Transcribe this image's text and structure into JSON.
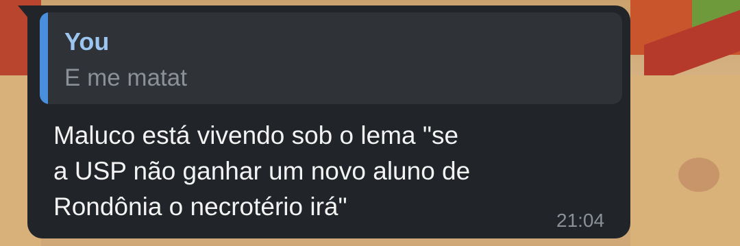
{
  "reply": {
    "author": "You",
    "text": "E me matat"
  },
  "message": {
    "lines": [
      "Maluco está vivendo sob o lema \"se",
      "a USP não ganhar um novo aluno de",
      "Rondônia o necrotério irá\""
    ],
    "time": "21:04"
  },
  "colors": {
    "bubble": "#212429",
    "reply_background": "#2f3237",
    "reply_accent": "#4a8fdd",
    "author": "#9cc6f0",
    "text": "#f3f3f3",
    "muted": "#8c9097"
  }
}
